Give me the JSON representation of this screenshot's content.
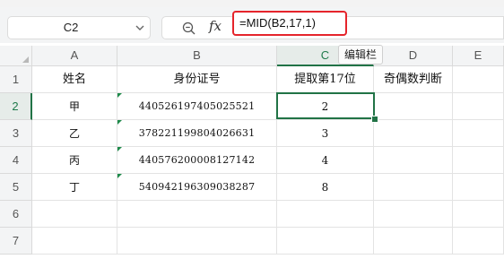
{
  "name_box": {
    "value": "C2"
  },
  "formula_bar": {
    "formula": "=MID(B2,17,1)",
    "fx_label": "fx"
  },
  "tooltip": {
    "text": "编辑栏"
  },
  "columns": [
    "A",
    "B",
    "C",
    "D",
    "E"
  ],
  "active_column": "C",
  "rows": [
    "1",
    "2",
    "3",
    "4",
    "5",
    "6",
    "7"
  ],
  "active_row": "2",
  "headers": {
    "a1": "姓名",
    "b1": "身份证号",
    "c1": "提取第17位",
    "d1": "奇偶数判断"
  },
  "data_rows": [
    {
      "name": "甲",
      "id": "440526197405025521",
      "digit": "2"
    },
    {
      "name": "乙",
      "id": "378221199804026631",
      "digit": "3"
    },
    {
      "name": "丙",
      "id": "440576200008127142",
      "digit": "4"
    },
    {
      "name": "丁",
      "id": "540942196309038287",
      "digit": "8"
    }
  ],
  "colors": {
    "selection": "#217346",
    "formula_highlight": "#e5242b"
  }
}
